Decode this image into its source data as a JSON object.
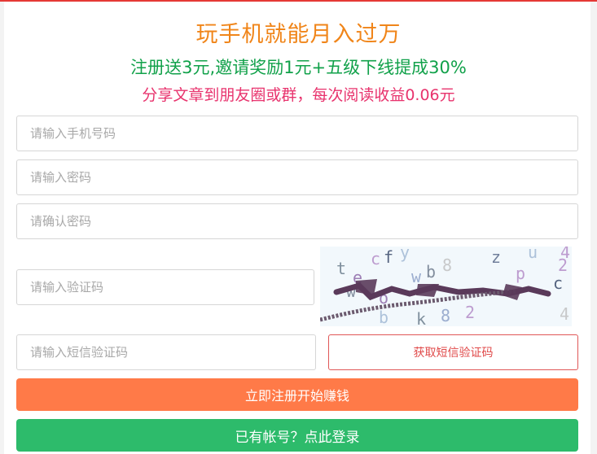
{
  "headline": "玩手机就能月入过万",
  "subheadline": "注册送3元,邀请奖励1元+五级下线提成30%",
  "promo": "分享文章到朋友圈或群，每次阅读收益0.06元",
  "form": {
    "phone_placeholder": "请输入手机号码",
    "password_placeholder": "请输入密码",
    "confirm_placeholder": "请确认密码",
    "captcha_placeholder": "请输入验证码",
    "sms_placeholder": "请输入短信验证码",
    "sms_button": "获取短信验证码",
    "register_button": "立即注册开始赚钱",
    "login_button": "已有帐号？点此登录"
  },
  "colors": {
    "headline": "#f08519",
    "subheadline": "#11a14a",
    "promo": "#e8336d",
    "register": "#ff7a48",
    "login": "#2dbb6b",
    "sms_border": "#e05757"
  }
}
